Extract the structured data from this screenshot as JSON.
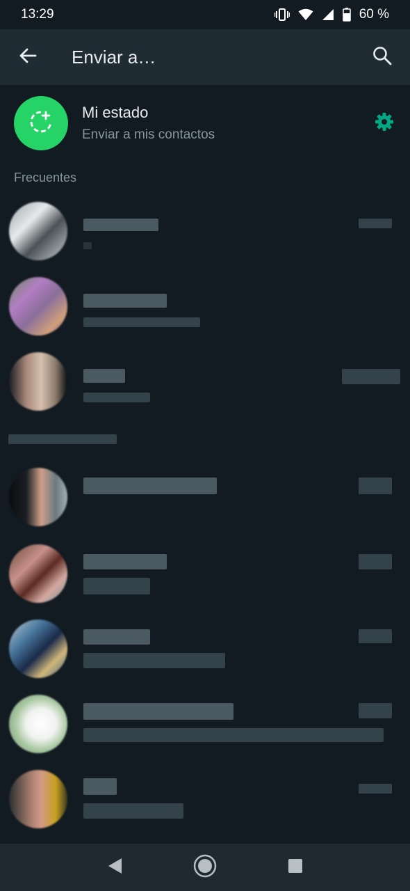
{
  "status_bar": {
    "time": "13:29",
    "battery": "60 %",
    "icons": [
      "vibrate-icon",
      "wifi-icon",
      "signal-icon",
      "battery-icon"
    ]
  },
  "app_bar": {
    "title": "Enviar a…",
    "back_icon": "arrow-back-icon",
    "search_icon": "search-icon"
  },
  "my_status": {
    "title": "Mi estado",
    "subtitle": "Enviar a mis contactos",
    "settings_icon": "gear-icon"
  },
  "sections": {
    "frequent": "Frecuentes"
  },
  "colors": {
    "background": "#111b21",
    "app_bar": "#202c33",
    "accent_green": "#25d366",
    "settings_teal": "#00a884",
    "secondary_text": "#8696a0"
  },
  "navigation": {
    "back": "nav-back-icon",
    "home": "nav-home-icon",
    "recents": "nav-recents-icon"
  }
}
